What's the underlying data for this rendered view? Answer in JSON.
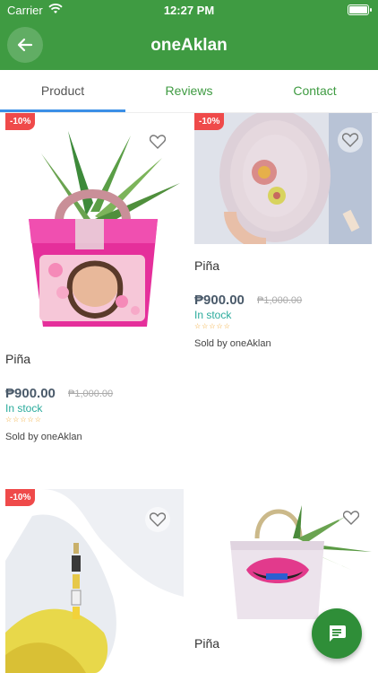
{
  "status_bar": {
    "carrier": "Carrier",
    "time": "12:27 PM"
  },
  "nav": {
    "title": "oneAklan",
    "back_icon": "arrow-left-icon"
  },
  "tabs": [
    {
      "label": "Product",
      "selected": true
    },
    {
      "label": "Reviews",
      "selected": false
    },
    {
      "label": "Contact",
      "selected": false
    }
  ],
  "products": [
    {
      "discount": "-10%",
      "name": "Piña",
      "price": "₱900.00",
      "old_price": "₱1,000.00",
      "stock": "In stock",
      "stars": "☆☆☆☆☆",
      "seller": "Sold by oneAklan"
    },
    {
      "discount": "-10%",
      "name": "Piña",
      "price": "₱900.00",
      "old_price": "₱1,000.00",
      "stock": "In stock",
      "stars": "☆☆☆☆☆",
      "seller": "Sold by oneAklan"
    },
    {
      "discount": "-10%",
      "name": "",
      "price": "",
      "old_price": "",
      "stock": "",
      "stars": "",
      "seller": ""
    },
    {
      "discount": "",
      "name": "Piña",
      "price": "",
      "old_price": "",
      "stock": "",
      "stars": "",
      "seller": ""
    }
  ],
  "colors": {
    "primary": "#3f9b42",
    "badge": "#ef4a4a",
    "stock": "#2bab9c",
    "indicator": "#3b8fe6"
  },
  "fab_icon": "chat-message-icon"
}
